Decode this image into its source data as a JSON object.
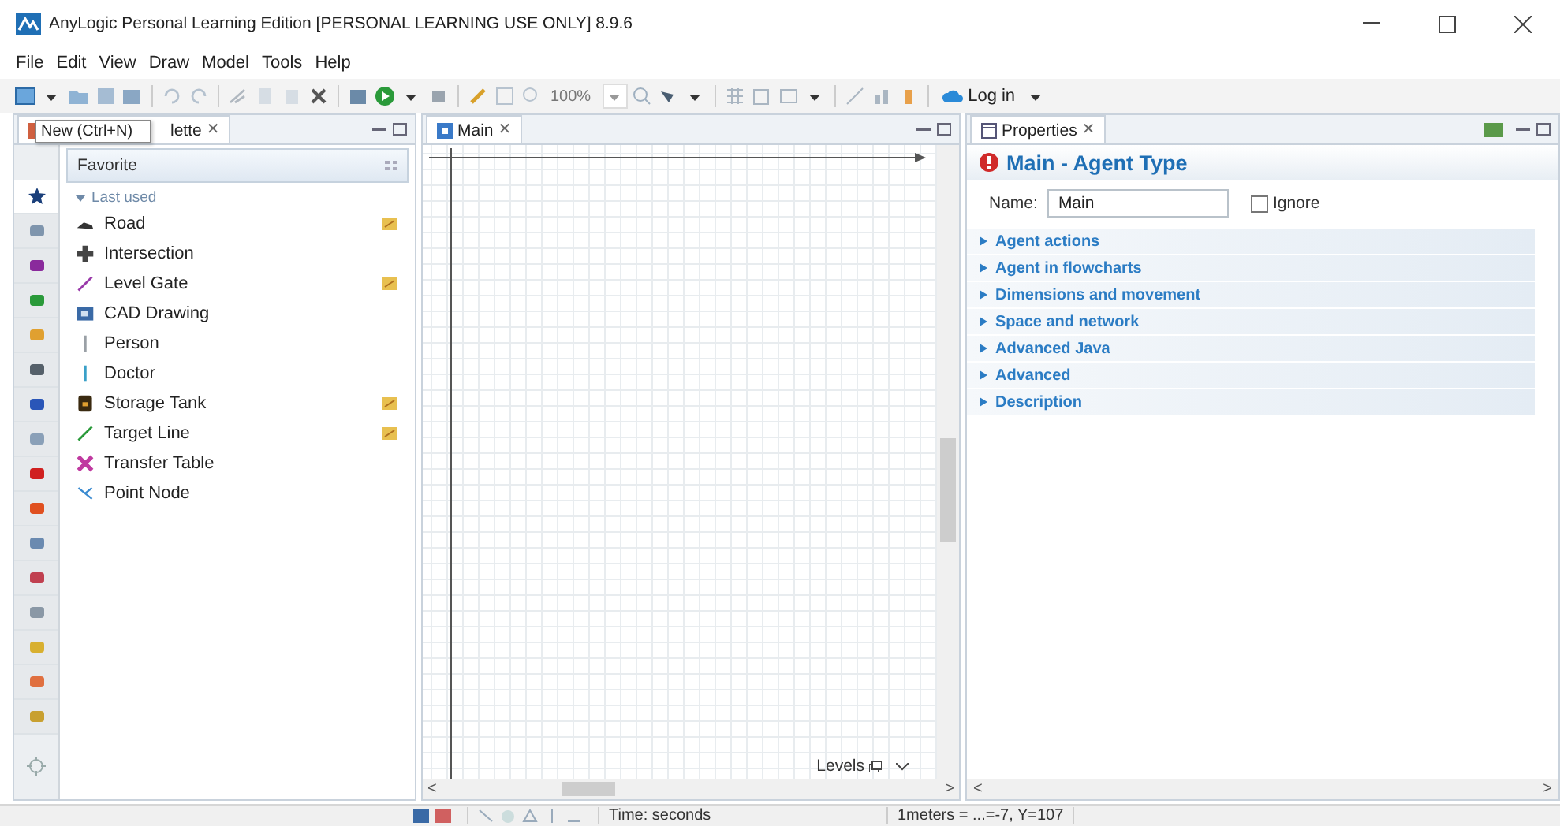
{
  "window": {
    "title": "AnyLogic Personal Learning Edition [PERSONAL LEARNING USE ONLY] 8.9.6"
  },
  "menu": [
    "File",
    "Edit",
    "View",
    "Draw",
    "Model",
    "Tools",
    "Help"
  ],
  "toolbar": {
    "zoom": "100%",
    "login": "Log in"
  },
  "tooltip": "New (Ctrl+N)",
  "palette": {
    "tab": "lette",
    "close": "✕",
    "group": "Favorite",
    "categories": [
      {
        "selected": true
      },
      {
        "selected": false
      },
      {
        "selected": false
      },
      {
        "selected": false
      },
      {
        "selected": false
      },
      {
        "selected": false
      },
      {
        "selected": false
      },
      {
        "selected": false
      },
      {
        "selected": false
      },
      {
        "selected": false
      },
      {
        "selected": false
      },
      {
        "selected": false
      },
      {
        "selected": false
      },
      {
        "selected": false
      },
      {
        "selected": false
      },
      {
        "selected": false
      }
    ],
    "section": {
      "label": "Last used",
      "expanded": true
    },
    "items": [
      {
        "label": "Road",
        "pinned": true
      },
      {
        "label": "Intersection",
        "pinned": false
      },
      {
        "label": "Level Gate",
        "pinned": true
      },
      {
        "label": "CAD Drawing",
        "pinned": false
      },
      {
        "label": "Person",
        "pinned": false
      },
      {
        "label": "Doctor",
        "pinned": false
      },
      {
        "label": "Storage Tank",
        "pinned": true
      },
      {
        "label": "Target Line",
        "pinned": true
      },
      {
        "label": "Transfer Table",
        "pinned": false
      },
      {
        "label": "Point Node",
        "pinned": false
      }
    ]
  },
  "editor": {
    "tab": "Main",
    "close": "✕",
    "levels": "Levels",
    "scroll_left": "<",
    "scroll_right": ">"
  },
  "properties": {
    "tab": "Properties",
    "close": "✕",
    "scroll_left": "<",
    "scroll_right": ">",
    "heading": "Main - Agent Type",
    "name_label": "Name:",
    "name_value": "Main",
    "ignore": {
      "label": "Ignore",
      "checked": false
    },
    "sections": [
      {
        "label": "Agent actions",
        "expanded": false
      },
      {
        "label": "Agent in flowcharts",
        "expanded": false
      },
      {
        "label": "Dimensions and movement",
        "expanded": false
      },
      {
        "label": "Space and network",
        "expanded": false
      },
      {
        "label": "Advanced Java",
        "expanded": false
      },
      {
        "label": "Advanced",
        "expanded": false
      },
      {
        "label": "Description",
        "expanded": false
      }
    ]
  },
  "status_bar": {
    "time": "Time: seconds",
    "coords": "1meters = ...=-7, Y=107"
  }
}
